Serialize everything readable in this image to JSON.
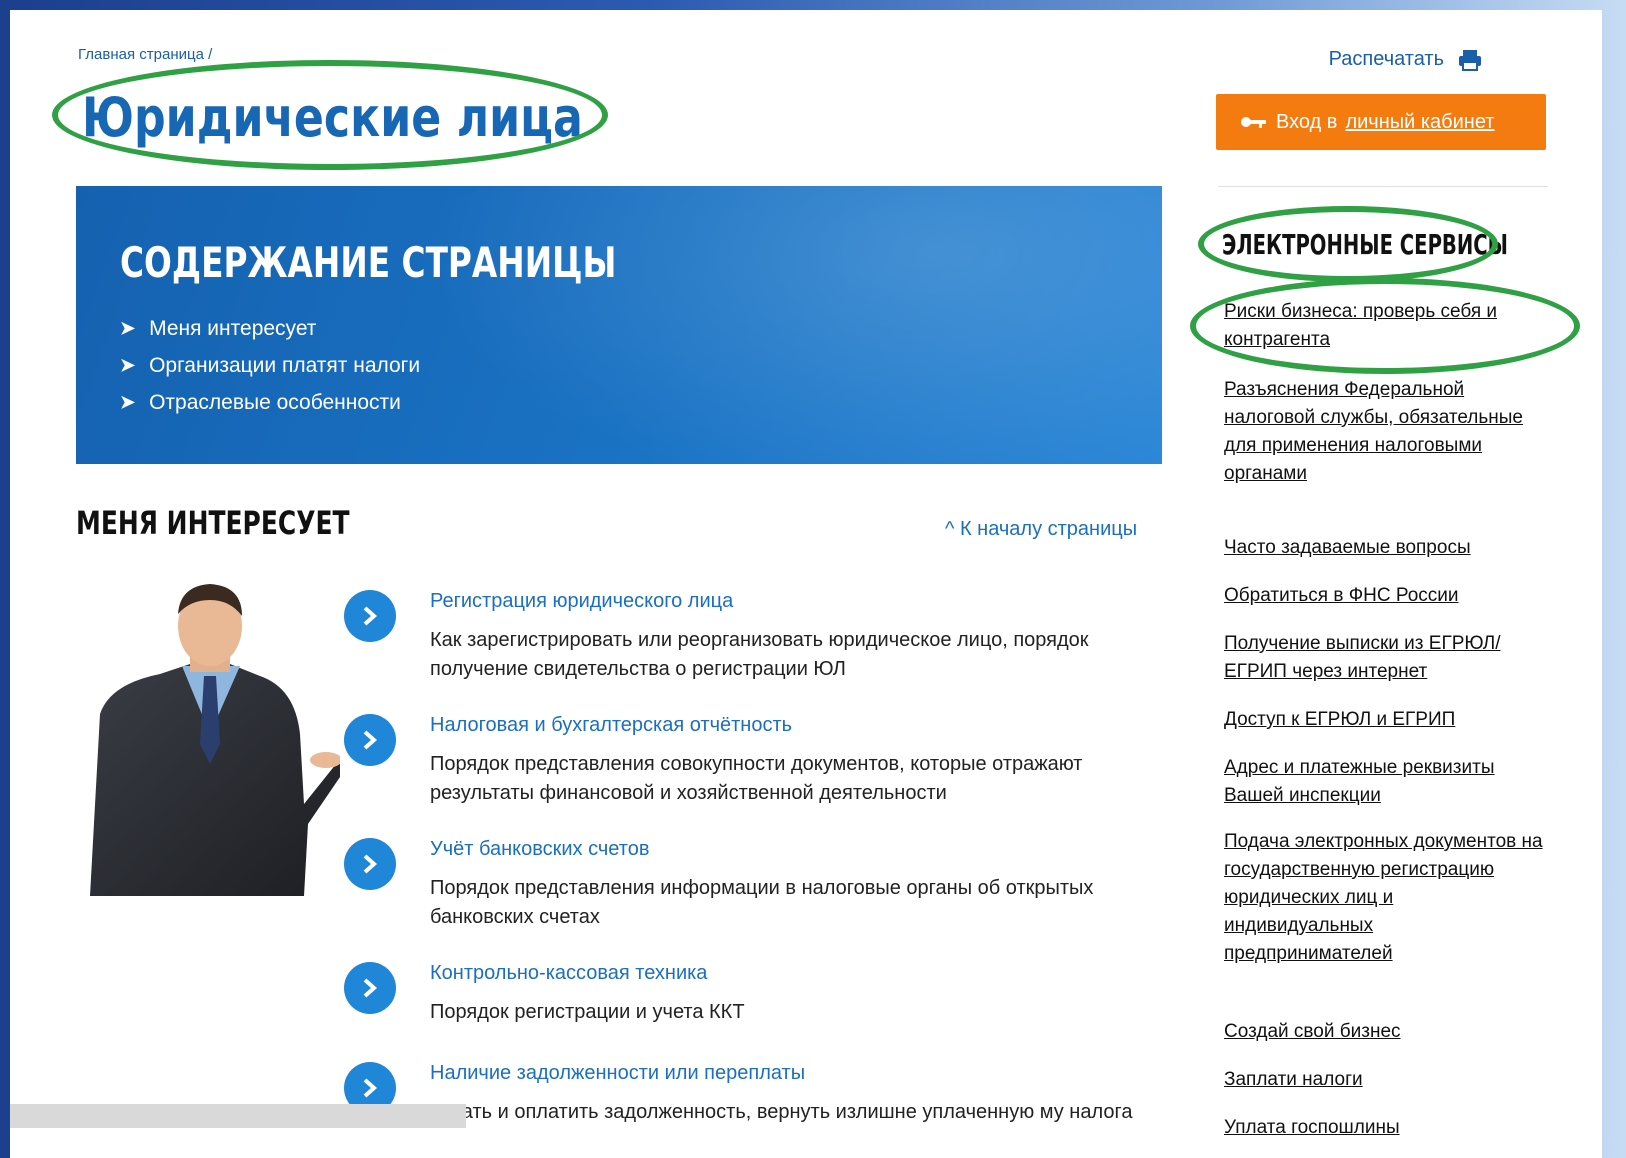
{
  "breadcrumb": {
    "home": "Главная страница /"
  },
  "page_title": "Юридические лица",
  "print_link": "Распечатать",
  "login": {
    "prefix": "Вход в",
    "link": "личный кабинет"
  },
  "banner": {
    "title": "СОДЕРЖАНИЕ СТРАНИЦЫ",
    "items": [
      "Меня интересует",
      "Организации платят налоги",
      "Отраслевые особенности"
    ]
  },
  "section": {
    "title": "МЕНЯ ИНТЕРЕСУЕТ",
    "to_top": "^ К началу страницы"
  },
  "topics": [
    {
      "title": "Регистрация юридического лица",
      "desc": "Как зарегистрировать или реорганизовать юридическое лицо, порядок получение свидетельства о регистрации ЮЛ"
    },
    {
      "title": "Налоговая и бухгалтерская отчётность",
      "desc": "Порядок представления совокупности документов, которые отражают результаты финансовой и хозяйственной деятельности"
    },
    {
      "title": "Учёт банковских счетов",
      "desc": "Порядок представления информации в налоговые органы об открытых банковских счетах"
    },
    {
      "title": "Контрольно-кассовая техника",
      "desc": "Порядок регистрации и учета ККТ"
    },
    {
      "title": "Наличие задолженности или переплаты",
      "desc": "Узнать и оплатить задолженность, вернуть излишне уплаченную му налога"
    }
  ],
  "sidebar": {
    "title": "ЭЛЕКТРОННЫЕ СЕРВИСЫ",
    "links": [
      "Риски бизнеса: проверь себя и контрагента",
      "Разъяснения Федеральной налоговой службы, обязательные для применения налоговыми органами",
      "Часто задаваемые вопросы",
      "Обратиться в ФНС России",
      "Получение выписки из ЕГРЮЛ/ЕГРИП через интернет",
      "Доступ к ЕГРЮЛ и ЕГРИП",
      "Адрес и платежные реквизиты Вашей инспекции",
      "Подача электронных документов на государственную регистрацию юридических лиц и индивидуальных предпринимателей",
      "Создай свой бизнес",
      "Заплати налоги",
      "Уплата госпошлины"
    ]
  },
  "colors": {
    "accent": "#1767b4",
    "button": "#f47b10",
    "highlight": "#2fa043"
  }
}
